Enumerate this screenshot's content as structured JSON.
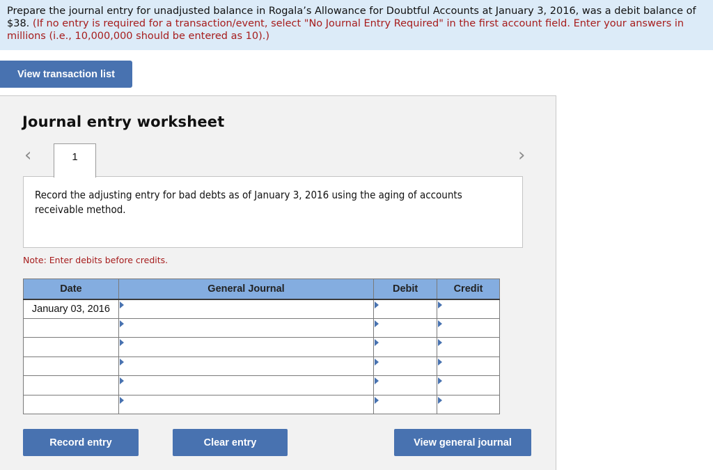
{
  "instructions": {
    "main_text": "Prepare the journal entry for unadjusted balance in Rogala’s Allowance for Doubtful Accounts at January 3, 2016, was a debit balance of $38. ",
    "hint_text": "(If no entry is required for a transaction/event, select \"No Journal Entry Required\" in the first account field. Enter your answers in millions (i.e., 10,000,000 should be entered as 10).)"
  },
  "buttons": {
    "view_transaction_list": "View transaction list",
    "record_entry": "Record entry",
    "clear_entry": "Clear entry",
    "view_general_journal": "View general journal"
  },
  "worksheet": {
    "title": "Journal entry worksheet",
    "prev_icon": "‹",
    "next_icon": "›",
    "tabs": [
      {
        "label": "1",
        "active": true
      }
    ],
    "description": "Record the adjusting entry for bad debts as of January 3, 2016 using the aging of accounts receivable method.",
    "note": "Note: Enter debits before credits."
  },
  "journal": {
    "headers": {
      "date": "Date",
      "general_journal": "General Journal",
      "debit": "Debit",
      "credit": "Credit"
    },
    "rows": [
      {
        "date": "January 03, 2016",
        "account": "",
        "debit": "",
        "credit": ""
      },
      {
        "date": "",
        "account": "",
        "debit": "",
        "credit": ""
      },
      {
        "date": "",
        "account": "",
        "debit": "",
        "credit": ""
      },
      {
        "date": "",
        "account": "",
        "debit": "",
        "credit": ""
      },
      {
        "date": "",
        "account": "",
        "debit": "",
        "credit": ""
      },
      {
        "date": "",
        "account": "",
        "debit": "",
        "credit": ""
      }
    ]
  },
  "colors": {
    "button_blue": "#4872b0",
    "header_blue": "#84ade0",
    "instruction_bg": "#dcebf8",
    "hint_red": "#a61c1c",
    "worksheet_bg": "#f2f2f2"
  }
}
